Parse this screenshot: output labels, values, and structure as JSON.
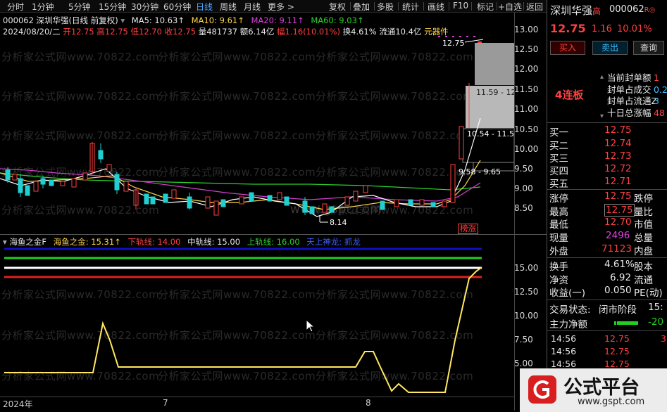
{
  "toolbar": {
    "left_items": [
      "分时",
      "1分钟",
      "5分钟",
      "15分钟",
      "30分钟",
      "60分钟",
      "日线",
      "周线",
      "月线",
      "更多 >"
    ],
    "active": "日线",
    "right_items": [
      "复权",
      "叠加",
      "多股",
      "统计",
      "画线",
      "F10",
      "标记",
      "+自选",
      "返回"
    ]
  },
  "chart_header": {
    "code_title": "000062 深圳华强(日线 前复权)",
    "ma5": "MA5: 10.63↑",
    "ma10": "MA10: 9.61↑",
    "ma20": "MA20: 9.11↑",
    "ma60": "MA60: 9.03↑",
    "date": "2024/08/20/二",
    "open": "开12.75",
    "high": "高12.75",
    "low": "低12.70",
    "close": "收12.75",
    "volume": "量481737",
    "amount": "额6.14亿",
    "change_pct": "幅1.16(10.01%)",
    "turnover": "换4.61%",
    "float": "流通10.4亿",
    "sector": "元器件"
  },
  "price_axis": [
    "13.00",
    "12.50",
    "12.00",
    "11.50",
    "11.00",
    "10.50",
    "10.00",
    "9.50",
    "9.00",
    "8.50"
  ],
  "price_annotations": {
    "limit_top": "12.75",
    "gap1": "11.59 - 12",
    "gap2": "10.54 - 11.5",
    "gap3": "9.58 - 9.65",
    "low_mark": "8.14",
    "tag": "榜涨"
  },
  "indicator_header": {
    "name": "海鱼之金F",
    "main": "海鱼之金: 15.31↑",
    "lower": "下轨线: 14.00",
    "middle": "中轨线: 15.00",
    "upper": "上轨线: 16.00",
    "extra": "天上神龙: 抓龙"
  },
  "indicator_axis": [
    "15.00",
    "12.50",
    "10.00",
    "7.50",
    "5.00"
  ],
  "time_axis": [
    "2024年",
    "7",
    "8"
  ],
  "watermark": "分析家公式网www.70822.com",
  "watermark_center": "www.gspt.com",
  "right_panel": {
    "name": "深圳华强",
    "name_suffix": "高",
    "code": "000062",
    "code_suffix": "R",
    "price": "12.75",
    "change": "1.16",
    "change_pct": "10.01%",
    "buy_btn": "买入",
    "sell_btn": "卖出",
    "query_btn": "查询",
    "streak": "4连板",
    "seal_labels": [
      "当前封单额",
      "封单占成交",
      "封单占流通Z",
      "十日总涨幅"
    ],
    "seal_values": [
      "1",
      "0.2",
      "3",
      "48"
    ],
    "bids": [
      {
        "label": "买一",
        "price": "12.75"
      },
      {
        "label": "买二",
        "price": "12.74"
      },
      {
        "label": "买三",
        "price": "12.73"
      },
      {
        "label": "买四",
        "price": "12.72"
      },
      {
        "label": "买五",
        "price": "12.71"
      }
    ],
    "stats": [
      {
        "l1": "涨停",
        "v1": "12.75",
        "l2": "跌停"
      },
      {
        "l1": "最高",
        "v1": "12.75",
        "l2": "量比"
      },
      {
        "l1": "最低",
        "v1": "12.70",
        "l2": "市值"
      },
      {
        "l1": "现量",
        "v1": "2496",
        "l2": "总量"
      },
      {
        "l1": "外盘",
        "v1": "71123",
        "l2": "内盘"
      }
    ],
    "fund": [
      {
        "l1": "换手",
        "v1": "4.61%",
        "l2": "股本"
      },
      {
        "l1": "净资",
        "v1": "6.92",
        "l2": "流通"
      },
      {
        "l1": "收益(一)",
        "v1": "0.050",
        "l2": "PE(动)"
      }
    ],
    "trade_status_label": "交易状态:",
    "trade_status_value": "闭市阶段",
    "trade_status_time": "15:",
    "main_net_label": "主力净额",
    "main_net_value": "-20",
    "ticks": [
      {
        "time": "14:56",
        "price": "12.75",
        "vol": "3"
      },
      {
        "time": "14:56",
        "price": "12.75",
        "vol": ""
      },
      {
        "time": "14:56",
        "price": "12.75",
        "vol": ""
      }
    ]
  },
  "logo": {
    "text": "公式平台",
    "url": "www.gspt.com"
  },
  "colors": {
    "up": "#ff4040",
    "down": "#20d0d0",
    "ma5": "#ffffff",
    "ma10": "#ffd54a",
    "ma20": "#e040e0",
    "ma60": "#2ad42a"
  }
}
